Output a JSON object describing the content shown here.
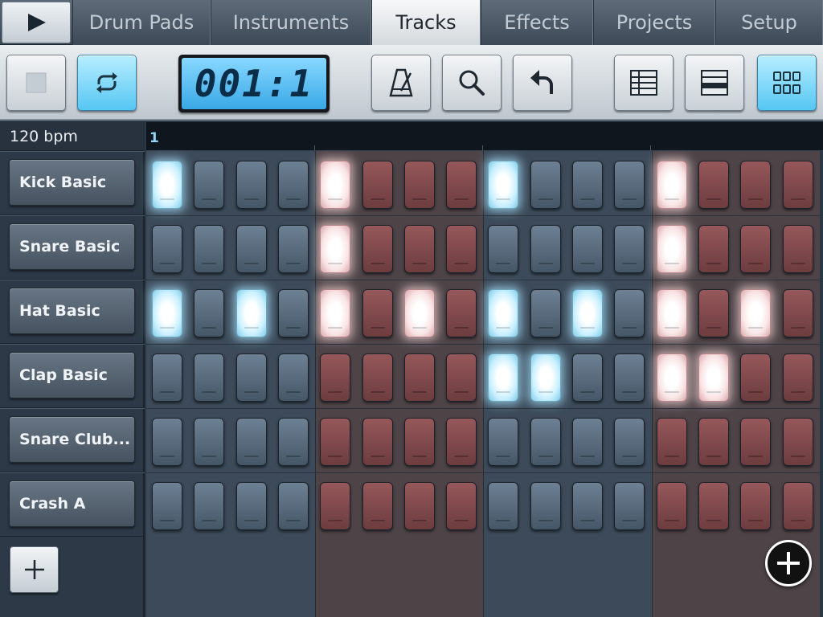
{
  "tabs": [
    "Drum Pads",
    "Instruments",
    "Tracks",
    "Effects",
    "Projects",
    "Setup"
  ],
  "active_tab": "Tracks",
  "toolbar": {
    "play_icon": "play-icon",
    "stop_icon": "stop-icon",
    "loop_icon": "loop-icon",
    "loop_active": true,
    "position_display": "001:1",
    "metronome_icon": "metronome-icon",
    "zoom_icon": "magnifier-icon",
    "undo_icon": "undo-icon",
    "view_list_icon": "list-view-icon",
    "view_split_icon": "split-view-icon",
    "view_grid_icon": "grid-view-icon",
    "grid_view_active": true
  },
  "tempo": "120 bpm",
  "ruler": {
    "bar_number": "1"
  },
  "tracks": [
    {
      "name": "Kick Basic",
      "steps": [
        1,
        0,
        0,
        0,
        1,
        0,
        0,
        0,
        1,
        0,
        0,
        0,
        1,
        0,
        0,
        0
      ]
    },
    {
      "name": "Snare Basic",
      "steps": [
        0,
        0,
        0,
        0,
        1,
        0,
        0,
        0,
        0,
        0,
        0,
        0,
        1,
        0,
        0,
        0
      ]
    },
    {
      "name": "Hat Basic",
      "steps": [
        1,
        0,
        1,
        0,
        1,
        0,
        1,
        0,
        1,
        0,
        1,
        0,
        1,
        0,
        1,
        0
      ]
    },
    {
      "name": "Clap Basic",
      "steps": [
        0,
        0,
        0,
        0,
        0,
        0,
        0,
        0,
        1,
        1,
        0,
        0,
        1,
        1,
        0,
        0
      ]
    },
    {
      "name": "Snare Club...",
      "steps": [
        0,
        0,
        0,
        0,
        0,
        0,
        0,
        0,
        0,
        0,
        0,
        0,
        0,
        0,
        0,
        0
      ]
    },
    {
      "name": "Crash A",
      "steps": [
        0,
        0,
        0,
        0,
        0,
        0,
        0,
        0,
        0,
        0,
        0,
        0,
        0,
        0,
        0,
        0
      ]
    }
  ],
  "beat_colors": [
    "blue",
    "red",
    "blue",
    "red"
  ],
  "colors": {
    "accent": "#56c6f3",
    "pad_blue": "#5a6c7e",
    "pad_red": "#844a4d"
  },
  "add_track_icon": "plus-icon",
  "add_pattern_icon": "plus-circle-icon"
}
